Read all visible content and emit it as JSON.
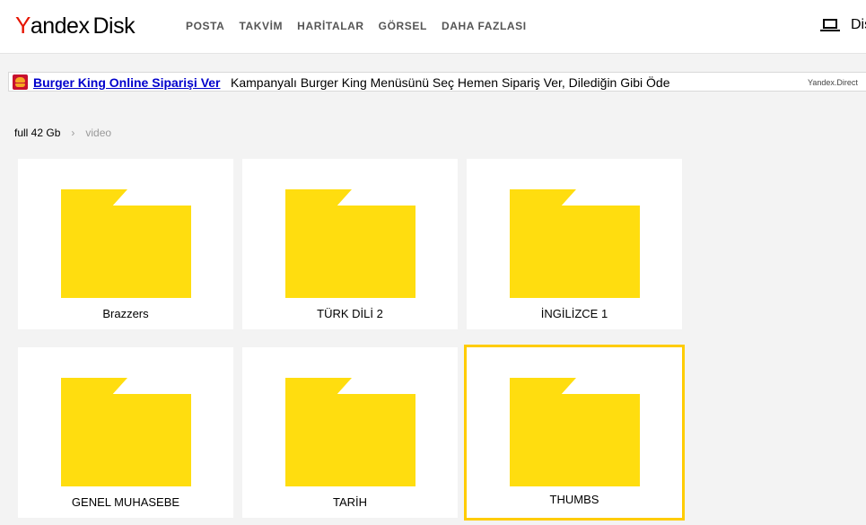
{
  "header": {
    "logo_y": "Y",
    "logo_andex": "andex",
    "logo_disk": "Disk",
    "nav": [
      "POSTA",
      "TAKVİM",
      "HARİTALAR",
      "GÖRSEL",
      "DAHA FAZLASI"
    ],
    "right_label": "Dis"
  },
  "ad": {
    "link": "Burger King Online Siparişi Ver",
    "text": "Kampanyalı Burger King Menüsünü Seç Hemen Sipariş Ver, Dilediğin Gibi Öde",
    "source": "Yandex.Direct"
  },
  "breadcrumb": {
    "root": "full 42 Gb",
    "separator": "›",
    "current": "video"
  },
  "folders": [
    {
      "name": "Brazzers"
    },
    {
      "name": "TÜRK DİLİ 2"
    },
    {
      "name": "İNGİLİZCE 1"
    },
    {
      "name": "GENEL MUHASEBE"
    },
    {
      "name": "TARİH"
    },
    {
      "name": "THUMBS",
      "selected": true
    }
  ],
  "colors": {
    "folder": "#ffdd0f",
    "selected_border": "#ffcc00",
    "logo_y": "#e61400",
    "ad_link": "#0000cc"
  }
}
